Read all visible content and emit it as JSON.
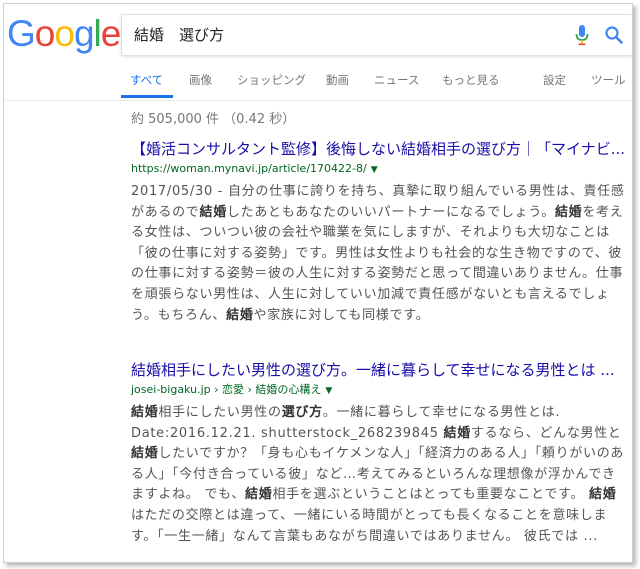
{
  "logo": {
    "letters": [
      "G",
      "o",
      "o",
      "g",
      "l",
      "e"
    ]
  },
  "search": {
    "query": "結婚　選び方"
  },
  "icons": {
    "mic": "microphone-icon",
    "search": "search-icon"
  },
  "colors": {
    "link": "#1a0dab",
    "url": "#006621",
    "tab_active": "#1a73e8",
    "snippet": "#545454",
    "muted": "#777777"
  },
  "tabs": [
    {
      "label": "すべて",
      "active": true
    },
    {
      "label": "画像"
    },
    {
      "label": "ショッピング"
    },
    {
      "label": "動画"
    },
    {
      "label": "ニュース"
    },
    {
      "label": "もっと見る"
    },
    {
      "label": "設定"
    },
    {
      "label": "ツール"
    }
  ],
  "stats": "約 505,000 件 （0.42 秒）",
  "results": [
    {
      "title": "【婚活コンサルタント監修】後悔しない結婚相手の選び方｜「マイナビ...",
      "url": "https://woman.mynavi.jp/article/170422-8/",
      "snippet": [
        {
          "t": "2017/05/30 - 自分の仕事に誇りを持ち、真摯に取り組んでいる男性は、責任感があるので"
        },
        {
          "t": "結婚",
          "b": true
        },
        {
          "t": "したあともあなたのいいパートナーになるでしょう。"
        },
        {
          "t": "結婚",
          "b": true
        },
        {
          "t": "を考える女性は、ついつい彼の会社や職業を気にしますが、それよりも大切なことは「彼の仕事に対する姿勢」です。男性は女性よりも社会的な生き物ですので、彼の仕事に対する姿勢＝彼の人生に対する姿勢だと思って間違いありません。仕事を頑張らない男性は、人生に対していい加減で責任感がないとも言えるでしょう。もちろん、"
        },
        {
          "t": "結婚",
          "b": true
        },
        {
          "t": "や家族に対しても同様です。"
        }
      ]
    },
    {
      "title": "結婚相手にしたい男性の選び方。一緒に暮らして幸せになる男性とは ...",
      "url": "josei-bigaku.jp › 恋愛 › 結婚の心構え",
      "snippet": [
        {
          "t": "結婚",
          "b": true
        },
        {
          "t": "相手にしたい男性の"
        },
        {
          "t": "選び方",
          "b": true
        },
        {
          "t": "。一緒に暮らして幸せになる男性とは. Date:2016.12.21. shutterstock_268239845 "
        },
        {
          "t": "結婚",
          "b": true
        },
        {
          "t": "するなら、どんな男性と"
        },
        {
          "t": "結婚",
          "b": true
        },
        {
          "t": "したいですか？「身も心もイケメンな人」「経済力のある人」「頼りがいのある人」「今付き合っている彼」など…考えてみるといろんな理想像が浮かんできますよね。 でも、"
        },
        {
          "t": "結婚",
          "b": true
        },
        {
          "t": "相手を選ぶということはとっても重要なことです。 "
        },
        {
          "t": "結婚",
          "b": true
        },
        {
          "t": "はただの交際とは違って、一緒にいる時間がとっても長くなることを意味します。「一生一緒」なんて言葉もあながち間違いではありません。 彼氏では ..."
        }
      ]
    }
  ]
}
